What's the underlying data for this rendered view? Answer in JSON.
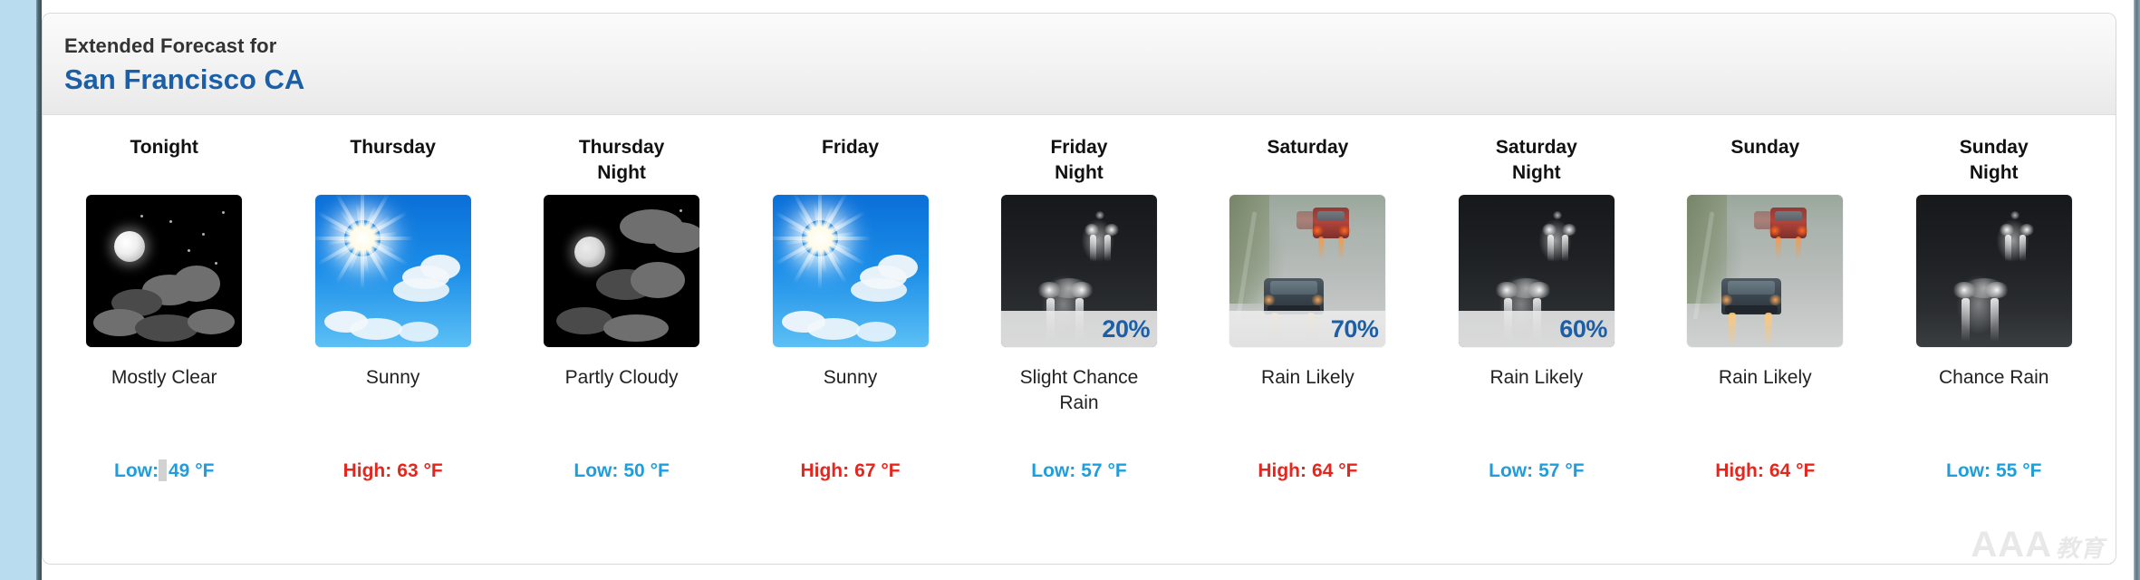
{
  "page": {
    "accent_blue": "#1b5fa8",
    "low_color": "#1f9ede",
    "high_color": "#e8251c",
    "watermark": "AAA",
    "watermark_cjk": "教育"
  },
  "header": {
    "subtitle": "Extended Forecast for",
    "location": "San Francisco CA"
  },
  "forecast": {
    "periods": [
      {
        "day": "Tonight",
        "day_line2": "",
        "icon": "night-mostly-clear-icon",
        "pop": "",
        "condition": "Mostly Clear",
        "condition_line2": "",
        "temp_label": "Low:",
        "temp_value": "49 °F",
        "temp_type": "low",
        "temp_full": "Low: 49 °F",
        "selected": true
      },
      {
        "day": "Thursday",
        "day_line2": "",
        "icon": "day-sunny-icon",
        "pop": "",
        "condition": "Sunny",
        "condition_line2": "",
        "temp_label": "High:",
        "temp_value": "63 °F",
        "temp_type": "high",
        "temp_full": "High: 63 °F",
        "selected": false
      },
      {
        "day": "Thursday",
        "day_line2": "Night",
        "icon": "night-partly-cloudy-icon",
        "pop": "",
        "condition": "Partly Cloudy",
        "condition_line2": "",
        "temp_label": "Low:",
        "temp_value": "50 °F",
        "temp_type": "low",
        "temp_full": "Low: 50 °F",
        "selected": false
      },
      {
        "day": "Friday",
        "day_line2": "",
        "icon": "day-sunny-icon",
        "pop": "",
        "condition": "Sunny",
        "condition_line2": "",
        "temp_label": "High:",
        "temp_value": "67 °F",
        "temp_type": "high",
        "temp_full": "High: 67 °F",
        "selected": false
      },
      {
        "day": "Friday",
        "day_line2": "Night",
        "icon": "night-rain-icon",
        "pop": "20%",
        "condition": "Slight Chance",
        "condition_line2": "Rain",
        "temp_label": "Low:",
        "temp_value": "57 °F",
        "temp_type": "low",
        "temp_full": "Low: 57 °F",
        "selected": false
      },
      {
        "day": "Saturday",
        "day_line2": "",
        "icon": "day-rain-icon",
        "pop": "70%",
        "condition": "Rain Likely",
        "condition_line2": "",
        "temp_label": "High:",
        "temp_value": "64 °F",
        "temp_type": "high",
        "temp_full": "High: 64 °F",
        "selected": false
      },
      {
        "day": "Saturday",
        "day_line2": "Night",
        "icon": "night-rain-icon",
        "pop": "60%",
        "condition": "Rain Likely",
        "condition_line2": "",
        "temp_label": "Low:",
        "temp_value": "57 °F",
        "temp_type": "low",
        "temp_full": "Low: 57 °F",
        "selected": false
      },
      {
        "day": "Sunday",
        "day_line2": "",
        "icon": "day-rain-icon",
        "pop": "",
        "condition": "Rain Likely",
        "condition_line2": "",
        "temp_label": "High:",
        "temp_value": "64 °F",
        "temp_type": "high",
        "temp_full": "High: 64 °F",
        "selected": false
      },
      {
        "day": "Sunday",
        "day_line2": "Night",
        "icon": "night-rain-icon",
        "pop": "",
        "condition": "Chance Rain",
        "condition_line2": "",
        "temp_label": "Low:",
        "temp_value": "55 °F",
        "temp_type": "low",
        "temp_full": "Low: 55 °F",
        "selected": false
      }
    ]
  }
}
